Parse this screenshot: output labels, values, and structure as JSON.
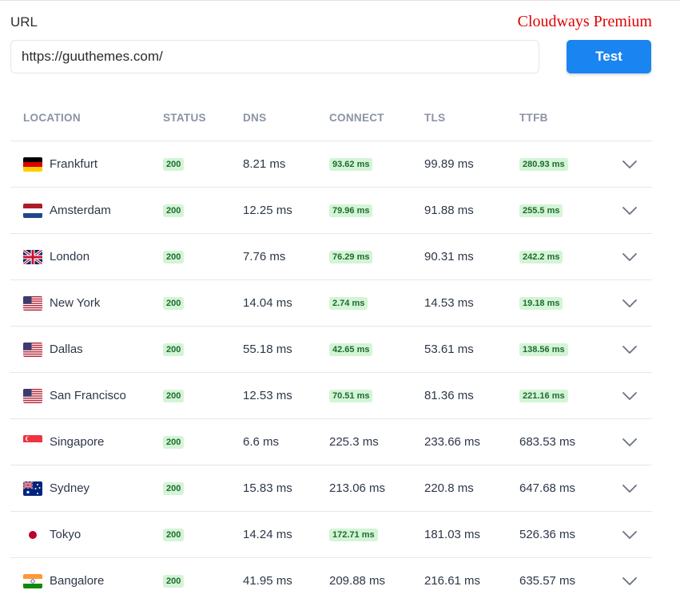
{
  "form": {
    "url_label": "URL",
    "url_value": "https://guuthemes.com/",
    "test_label": "Test"
  },
  "annotation": "Cloudways Premium",
  "colors": {
    "accent": "#1a85f0",
    "badge_bg": "#d4f4d6",
    "badge_text": "#1d6b30",
    "annotation": "#e00000"
  },
  "table": {
    "headers": [
      "LOCATION",
      "STATUS",
      "DNS",
      "CONNECT",
      "TLS",
      "TTFB"
    ],
    "rows": [
      {
        "flag": "germany-flag-icon",
        "location": "Frankfurt",
        "status": "200",
        "dns": "8.21 ms",
        "connect": "93.62 ms",
        "connect_badge": true,
        "tls": "99.89 ms",
        "ttfb": "280.93 ms",
        "ttfb_badge": true
      },
      {
        "flag": "netherlands-flag-icon",
        "location": "Amsterdam",
        "status": "200",
        "dns": "12.25 ms",
        "connect": "79.96 ms",
        "connect_badge": true,
        "tls": "91.88 ms",
        "ttfb": "255.5 ms",
        "ttfb_badge": true
      },
      {
        "flag": "uk-flag-icon",
        "location": "London",
        "status": "200",
        "dns": "7.76 ms",
        "connect": "76.29 ms",
        "connect_badge": true,
        "tls": "90.31 ms",
        "ttfb": "242.2 ms",
        "ttfb_badge": true
      },
      {
        "flag": "usa-flag-icon",
        "location": "New York",
        "status": "200",
        "dns": "14.04 ms",
        "connect": "2.74 ms",
        "connect_badge": true,
        "tls": "14.53 ms",
        "ttfb": "19.18 ms",
        "ttfb_badge": true
      },
      {
        "flag": "usa-flag-icon",
        "location": "Dallas",
        "status": "200",
        "dns": "55.18 ms",
        "connect": "42.65 ms",
        "connect_badge": true,
        "tls": "53.61 ms",
        "ttfb": "138.56 ms",
        "ttfb_badge": true
      },
      {
        "flag": "usa-flag-icon",
        "location": "San Francisco",
        "status": "200",
        "dns": "12.53 ms",
        "connect": "70.51 ms",
        "connect_badge": true,
        "tls": "81.36 ms",
        "ttfb": "221.16 ms",
        "ttfb_badge": true
      },
      {
        "flag": "singapore-flag-icon",
        "location": "Singapore",
        "status": "200",
        "dns": "6.6 ms",
        "connect": "225.3 ms",
        "connect_badge": false,
        "tls": "233.66 ms",
        "ttfb": "683.53 ms",
        "ttfb_badge": false
      },
      {
        "flag": "australia-flag-icon",
        "location": "Sydney",
        "status": "200",
        "dns": "15.83 ms",
        "connect": "213.06 ms",
        "connect_badge": false,
        "tls": "220.8 ms",
        "ttfb": "647.68 ms",
        "ttfb_badge": false
      },
      {
        "flag": "japan-flag-icon",
        "location": "Tokyo",
        "status": "200",
        "dns": "14.24 ms",
        "connect": "172.71 ms",
        "connect_badge": true,
        "tls": "181.03 ms",
        "ttfb": "526.36 ms",
        "ttfb_badge": false
      },
      {
        "flag": "india-flag-icon",
        "location": "Bangalore",
        "status": "200",
        "dns": "41.95 ms",
        "connect": "209.88 ms",
        "connect_badge": false,
        "tls": "216.61 ms",
        "ttfb": "635.57 ms",
        "ttfb_badge": false
      }
    ]
  }
}
